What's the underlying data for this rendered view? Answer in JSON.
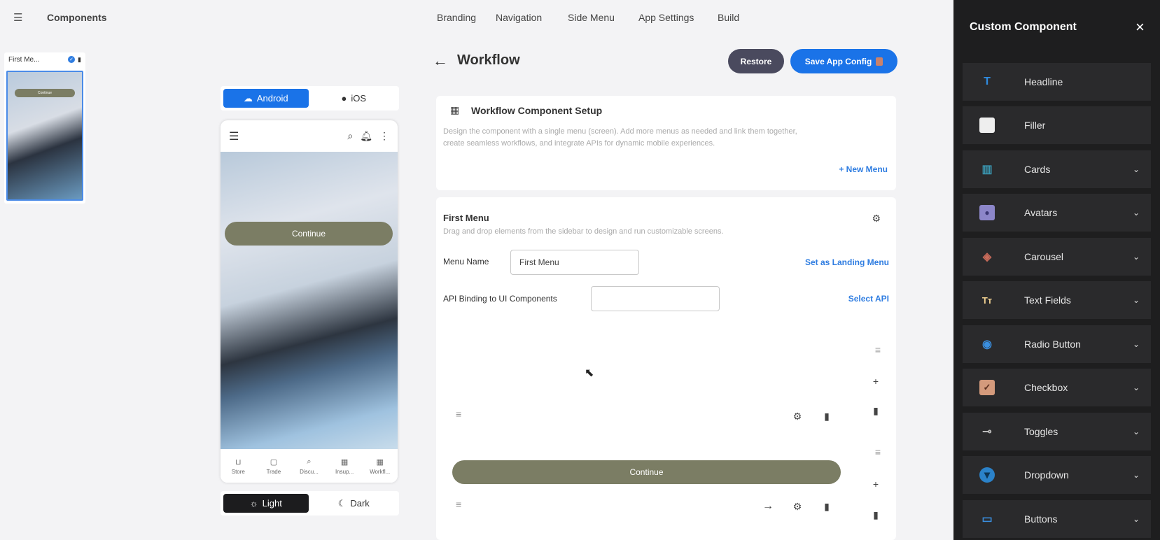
{
  "topbar": {
    "title": "Components",
    "nav": [
      "Branding",
      "Navigation",
      "Side Menu",
      "App Settings",
      "Build"
    ]
  },
  "thumbnail": {
    "label": "First Me...",
    "button": "Continue"
  },
  "platform": {
    "android": "Android",
    "ios": "iOS"
  },
  "phone": {
    "button": "Continue",
    "tabs": [
      "Store",
      "Trade",
      "Discu...",
      "Insup...",
      "Workfl..."
    ]
  },
  "theme": {
    "light": "Light",
    "dark": "Dark"
  },
  "header": {
    "title": "Workflow",
    "restore": "Restore",
    "save": "Save App Config"
  },
  "setup": {
    "title": "Workflow Component Setup",
    "desc_line1": "Design the component with a single menu (screen). Add more menus as needed and link them together,",
    "desc_line2": "create seamless workflows, and integrate APIs for dynamic mobile experiences.",
    "new_menu": "+ New Menu"
  },
  "menu": {
    "title": "First Menu",
    "desc": "Drag and drop elements from the sidebar to design and run customizable screens.",
    "name_label": "Menu Name",
    "name_value": "First Menu",
    "landing": "Set as Landing Menu",
    "api_label": "API Binding to UI Components",
    "api_value": "",
    "select_api": "Select API",
    "continue": "Continue"
  },
  "panel": {
    "title": "Custom Component",
    "items": [
      {
        "label": "Headline",
        "icon": "T"
      },
      {
        "label": "Filler",
        "icon": ""
      },
      {
        "label": "Cards",
        "icon": "▥"
      },
      {
        "label": "Avatars",
        "icon": "●"
      },
      {
        "label": "Carousel",
        "icon": "◈"
      },
      {
        "label": "Text Fields",
        "icon": "Tт"
      },
      {
        "label": "Radio Button",
        "icon": "◉"
      },
      {
        "label": "Checkbox",
        "icon": "✓"
      },
      {
        "label": "Toggles",
        "icon": "⊸"
      },
      {
        "label": "Dropdown",
        "icon": "▾"
      },
      {
        "label": "Buttons",
        "icon": "▭"
      }
    ]
  },
  "colors": {
    "accent": "#1a73e8",
    "restore_bg": "#4a4a5e",
    "olive": "#7b7d64",
    "panel_bg": "#1e1e1f"
  }
}
